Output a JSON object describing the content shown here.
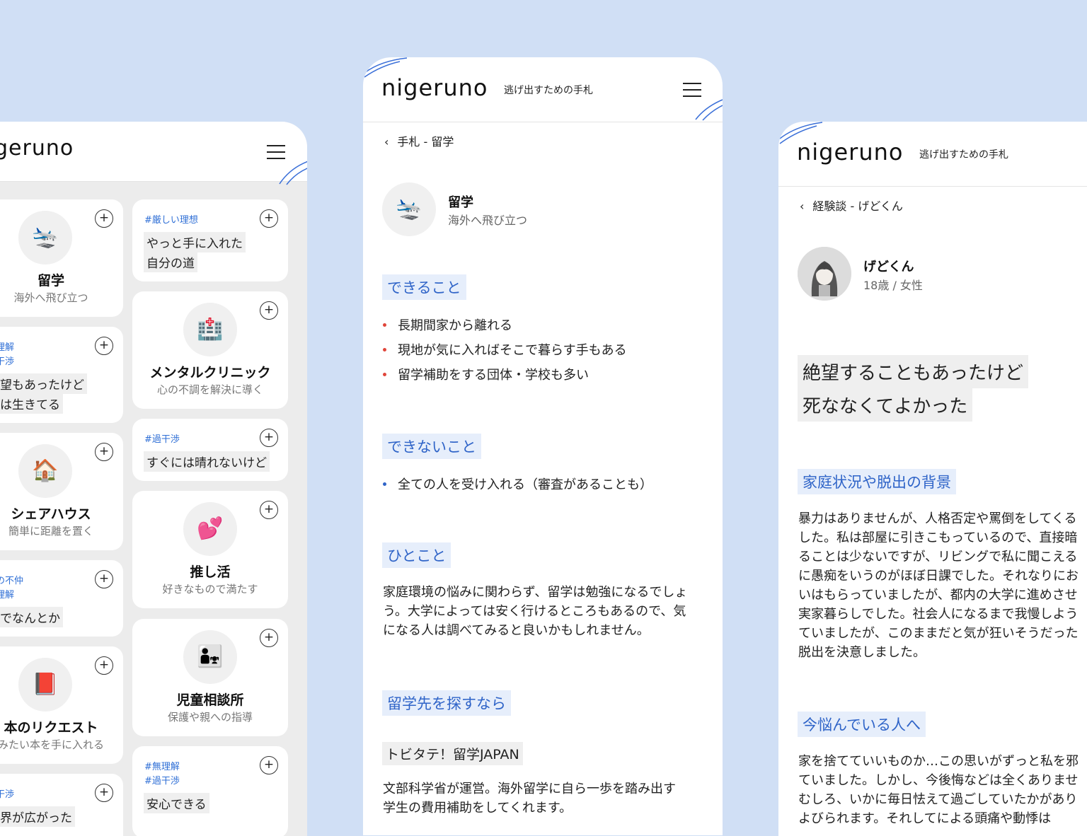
{
  "brand": {
    "logo": "nigeruno",
    "tagline": "逃げ出すための手札"
  },
  "left": {
    "logo_partial": "geruno",
    "col1": [
      {
        "type": "item",
        "emoji": "🛬",
        "title": "留学",
        "sub": "海外へ飛び立つ"
      },
      {
        "type": "quote",
        "tags": [
          "理解",
          "干渉"
        ],
        "lines": [
          "望もあったけど",
          "は生きてる"
        ]
      },
      {
        "type": "item",
        "emoji": "🏠",
        "title": "シェアハウス",
        "sub": "簡単に距離を置く"
      },
      {
        "type": "quote",
        "tags": [
          "の不仲",
          "理解"
        ],
        "lines": [
          "でなんとか"
        ]
      },
      {
        "type": "item",
        "emoji": "📕",
        "title": "本のリクエスト",
        "sub": "みたい本を手に入れる"
      },
      {
        "type": "quote",
        "tags": [
          "干渉"
        ],
        "lines": [
          "界が広がった"
        ]
      }
    ],
    "col2": [
      {
        "type": "quote",
        "tags": [
          "#厳しい理想"
        ],
        "lines": [
          "やっと手に入れた",
          "自分の道"
        ]
      },
      {
        "type": "item",
        "emoji": "🏥",
        "title": "メンタルクリニック",
        "sub": "心の不調を解決に導く"
      },
      {
        "type": "quote",
        "tags": [
          "#過干渉"
        ],
        "lines": [
          "すぐには晴れないけど"
        ]
      },
      {
        "type": "item",
        "emoji": "💕",
        "title": "推し活",
        "sub": "好きなもので満たす"
      },
      {
        "type": "item",
        "emoji": "👨‍👧",
        "title": "児童相談所",
        "sub": "保護や親への指導"
      },
      {
        "type": "quote",
        "tags": [
          "#無理解",
          "#過干渉"
        ],
        "lines": [
          "安心できる"
        ]
      }
    ]
  },
  "center": {
    "breadcrumb": "手札 - 留学",
    "emoji": "🛬",
    "title": "留学",
    "subtitle": "海外へ飛び立つ",
    "can_head": "できること",
    "can_items": [
      "長期間家から離れる",
      "現地が気に入ればそこで暮らす手もある",
      "留学補助をする団体・学校も多い"
    ],
    "cannot_head": "できないこと",
    "cannot_items": [
      "全ての人を受け入れる（審査があることも）"
    ],
    "word_head": "ひとこと",
    "word_lines": [
      "家庭環境の悩みに関わらず、留学は勉強になるでしょ",
      "う。大学によっては安く行けるところもあるので、気",
      "になる人は調べてみると良いかもしれません。"
    ],
    "find_head": "留学先を探すなら",
    "resource_name": "トビタテ！留学JAPAN",
    "resource_lines": [
      "文部科学省が運営。海外留学に自ら一歩を踏み出す",
      "学生の費用補助をしてくれます。"
    ]
  },
  "right": {
    "breadcrumb": "経験談 - げどくん",
    "name": "げどくん",
    "meta": "18歳 / 女性",
    "quote_lines": [
      "絶望することもあったけど",
      "死ななくてよかった"
    ],
    "bg_head": "家庭状況や脱出の背景",
    "bg_lines": [
      "暴力はありませんが、人格否定や罵倒をしてくる",
      "した。私は部屋に引きこもっているので、直接暗",
      "ることは少ないですが、リビングで私に聞こえる",
      "に愚痴をいうのがほぼ日課でした。それなりにお",
      "いはもらっていましたが、都内の大学に進めさせ",
      "実家暮らしでした。社会人になるまで我慢しよう",
      "ていましたが、このままだと気が狂いそうだった",
      "脱出を決意しました。"
    ],
    "now_head": "今悩んでいる人へ",
    "now_lines": [
      "家を捨てていいものか…この思いがずっと私を邪",
      "ていました。しかし、今後悔などは全くありませ",
      "むしろ、いかに毎日怯えて過ごしていたかがあり",
      "よびられます。それしてによる頭痛や動悸は"
    ]
  },
  "colors": {
    "background": "#d0dff5",
    "accent": "#2f64c8",
    "red_bullet": "#e0453a",
    "blue_bullet": "#2f64c8",
    "chip": "#efefef"
  }
}
